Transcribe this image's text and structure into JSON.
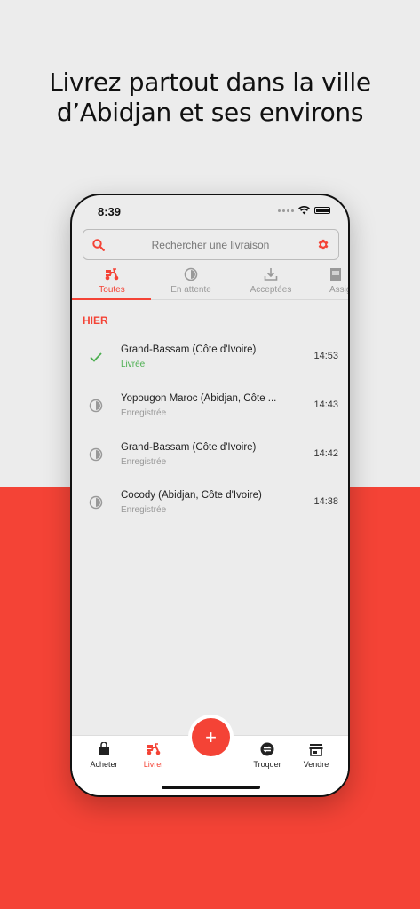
{
  "headline": {
    "line1": "Livrez partout dans la ville",
    "line2": "d’Abidjan et ses environs"
  },
  "status_bar": {
    "time": "8:39"
  },
  "search": {
    "placeholder": "Rechercher une livraison"
  },
  "tabs": [
    {
      "label": "Toutes",
      "icon": "scooter-icon",
      "active": true
    },
    {
      "label": "En attente",
      "icon": "half-circle-icon"
    },
    {
      "label": "Acceptées",
      "icon": "download-icon"
    },
    {
      "label": "Assig",
      "icon": "document-icon"
    }
  ],
  "section_label": "HIER",
  "deliveries": [
    {
      "title": "Grand-Bassam (Côte d'Ivoire)",
      "status": "Livrée",
      "time": "14:53",
      "icon": "check-icon"
    },
    {
      "title": "Yopougon Maroc (Abidjan, Côte ...",
      "status": "Enregistrée",
      "time": "14:43",
      "icon": "half-circle-icon"
    },
    {
      "title": "Grand-Bassam (Côte d'Ivoire)",
      "status": "Enregistrée",
      "time": "14:42",
      "icon": "half-circle-icon"
    },
    {
      "title": "Cocody (Abidjan, Côte d'Ivoire)",
      "status": "Enregistrée",
      "time": "14:38",
      "icon": "half-circle-icon"
    }
  ],
  "bottom_nav": [
    {
      "label": "Acheter",
      "icon": "shopping-bag-icon"
    },
    {
      "label": "Livrer",
      "icon": "scooter-icon",
      "active": true
    },
    {
      "label": "Troquer",
      "icon": "exchange-icon"
    },
    {
      "label": "Vendre",
      "icon": "store-icon"
    }
  ],
  "fab": {
    "label": "+"
  },
  "colors": {
    "accent": "#f44336",
    "success": "#4caf50",
    "background": "#ececec"
  }
}
